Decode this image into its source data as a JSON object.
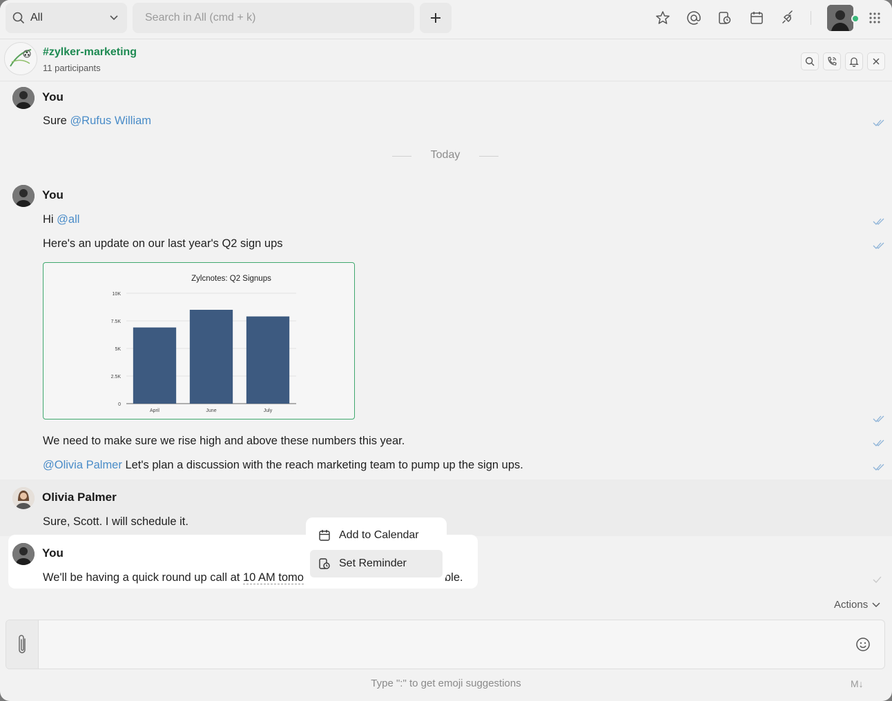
{
  "topbar": {
    "scope_label": "All",
    "search_placeholder": "Search in All (cmd + k)",
    "new_label": "+"
  },
  "channel": {
    "name": "#zylker-marketing",
    "participants": "11 participants"
  },
  "messages": [
    {
      "author": "You",
      "lines": [
        {
          "text": "Sure ",
          "mention": "@Rufus William",
          "rest": ""
        }
      ]
    },
    {
      "divider": "Today"
    },
    {
      "author": "You",
      "lines": [
        {
          "text": "Hi ",
          "mention": "@all",
          "rest": ""
        },
        {
          "text": "Here's an update on our last year's Q2 sign ups"
        },
        {
          "text": "We need to make sure we rise high and above these numbers this year."
        },
        {
          "mention": "@Olivia Palmer",
          "rest": " Let's plan a discussion with the reach marketing team to pump up the sign ups."
        }
      ]
    },
    {
      "author": "Olivia Palmer",
      "lines": [
        {
          "text": "Sure, Scott. I will schedule it."
        }
      ]
    },
    {
      "author": "You",
      "lines": [
        {
          "text": "We'll be having a quick round up call at ",
          "highlight": "10 AM tomo",
          "tail": "ble."
        }
      ]
    }
  ],
  "chart_data": {
    "type": "bar",
    "title": "Zylcnotes: Q2 Signups",
    "categories": [
      "April",
      "June",
      "July"
    ],
    "values": [
      6900,
      8500,
      7900
    ],
    "ylim": [
      0,
      10000
    ],
    "yticks": [
      "0",
      "2.5K",
      "5K",
      "7.5K",
      "10K"
    ],
    "ytick_values": [
      0,
      2500,
      5000,
      7500,
      10000
    ],
    "bar_color": "#3d5a80",
    "grid": true
  },
  "popup": {
    "items": [
      {
        "label": "Add to Calendar",
        "icon": "calendar-icon"
      },
      {
        "label": "Set Reminder",
        "icon": "reminder-icon"
      }
    ]
  },
  "actions_label": "Actions",
  "composer": {
    "hint": "Type \":\" to get emoji suggestions",
    "markdown": "M↓"
  },
  "colors": {
    "accent_green": "#1e8a52",
    "mention_blue": "#4a8cc8",
    "chart_border": "#3fa86e"
  }
}
